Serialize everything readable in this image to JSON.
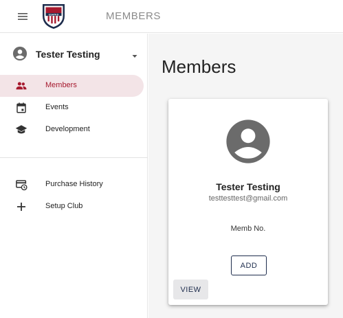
{
  "header": {
    "title": "MEMBERS",
    "logo_text": "USATKD",
    "menu_icon": "hamburger-menu-icon"
  },
  "user": {
    "name": "Tester Testing",
    "avatar_icon": "account-circle-icon",
    "caret_icon": "caret-down-icon"
  },
  "sidebar": {
    "items": [
      {
        "label": "Members",
        "icon": "people-icon",
        "active": true
      },
      {
        "label": "Events",
        "icon": "calendar-icon",
        "active": false
      },
      {
        "label": "Development",
        "icon": "graduation-cap-icon",
        "active": false
      },
      {
        "label": "Purchase History",
        "icon": "card-history-icon",
        "active": false
      },
      {
        "label": "Setup Club",
        "icon": "plus-icon",
        "active": false
      }
    ]
  },
  "main": {
    "title": "Members",
    "card": {
      "name": "Tester Testing",
      "email": "testtesttest@gmail.com",
      "memb_label": "Memb No.",
      "add_label": "ADD",
      "view_label": "VIEW"
    }
  },
  "colors": {
    "accent": "#a6192e",
    "active_bg": "#f3e4e7",
    "navy": "#1d2c4c",
    "main_bg": "#f5f5f5"
  }
}
